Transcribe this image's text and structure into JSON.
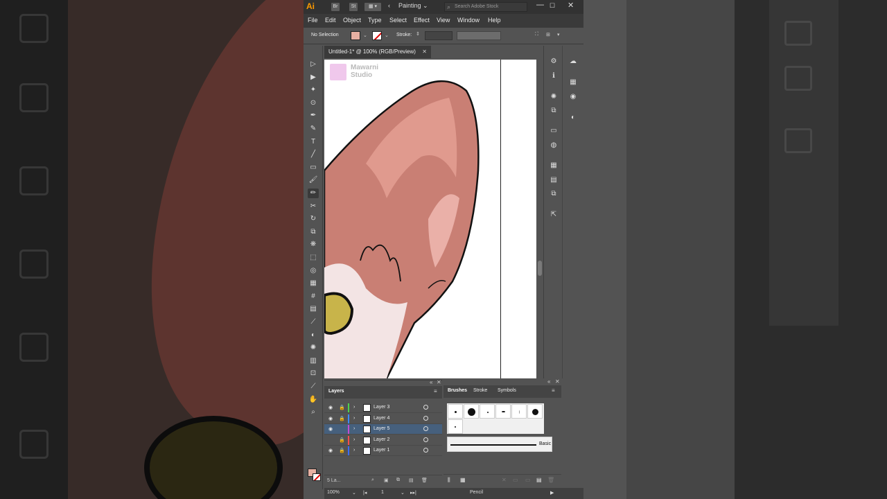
{
  "app": {
    "logo": "Ai",
    "bridge_btn": "Br",
    "stock_btn": "St",
    "workspace": "Painting",
    "stock_search_placeholder": "Search Adobe Stock",
    "window_controls": [
      "—",
      "☐",
      "✕"
    ]
  },
  "menubar": [
    "File",
    "Edit",
    "Object",
    "Type",
    "Select",
    "Effect",
    "View",
    "Window",
    "Help"
  ],
  "control_bar": {
    "selection": "No Selection",
    "stroke_label": "Stroke:",
    "fill_color": "#e8b0a2"
  },
  "document": {
    "tab_title": "Untitled-1* @ 100% (RGB/Preview)",
    "close": "✕",
    "watermark": "Mawarni Studio"
  },
  "tools": [
    {
      "name": "selection-tool",
      "glyph": "▷"
    },
    {
      "name": "direct-selection-tool",
      "glyph": "▶"
    },
    {
      "name": "magic-wand-tool",
      "glyph": "✦"
    },
    {
      "name": "lasso-tool",
      "glyph": "⊙"
    },
    {
      "name": "pen-tool",
      "glyph": "✒"
    },
    {
      "name": "curvature-tool",
      "glyph": "✎"
    },
    {
      "name": "type-tool",
      "glyph": "T"
    },
    {
      "name": "line-tool",
      "glyph": "╱"
    },
    {
      "name": "rectangle-tool",
      "glyph": "▭"
    },
    {
      "name": "paintbrush-tool",
      "glyph": "🖌"
    },
    {
      "name": "pencil-tool",
      "glyph": "✏"
    },
    {
      "name": "scissors-tool",
      "glyph": "✂"
    },
    {
      "name": "rotate-tool",
      "glyph": "↻"
    },
    {
      "name": "scale-tool",
      "glyph": "⧉"
    },
    {
      "name": "warp-tool",
      "glyph": "❋"
    },
    {
      "name": "free-transform-tool",
      "glyph": "⬚"
    },
    {
      "name": "shape-builder-tool",
      "glyph": "◎"
    },
    {
      "name": "perspective-grid-tool",
      "glyph": "▦"
    },
    {
      "name": "mesh-tool",
      "glyph": "#"
    },
    {
      "name": "gradient-tool",
      "glyph": "▤"
    },
    {
      "name": "eyedropper-tool",
      "glyph": "⟋"
    },
    {
      "name": "blend-tool",
      "glyph": "◐"
    },
    {
      "name": "symbol-sprayer-tool",
      "glyph": "✺"
    },
    {
      "name": "column-graph-tool",
      "glyph": "▥"
    },
    {
      "name": "artboard-tool",
      "glyph": "⊡"
    },
    {
      "name": "slice-tool",
      "glyph": "⟋"
    },
    {
      "name": "hand-tool",
      "glyph": "✋"
    },
    {
      "name": "zoom-tool",
      "glyph": "⌕"
    }
  ],
  "right_panel_icons_a": [
    "⚙",
    "ℹ",
    "✺",
    "⧉",
    "▭",
    "◍",
    "▦",
    "▤",
    "⧉",
    "⇱"
  ],
  "right_panel_icons_b": [
    "☁",
    "▦",
    "◉",
    "◐"
  ],
  "layers_panel": {
    "tab": "Layers",
    "count_label": "5 La...",
    "layers": [
      {
        "name": "Layer 3",
        "color": "#4cd34c",
        "visible": true,
        "locked": true,
        "selected": false
      },
      {
        "name": "Layer 4",
        "color": "#3a8cff",
        "visible": true,
        "locked": true,
        "selected": false
      },
      {
        "name": "Layer 5",
        "color": "#c34cd3",
        "visible": true,
        "locked": false,
        "selected": true
      },
      {
        "name": "Layer 2",
        "color": "#ff4c4c",
        "visible": false,
        "locked": true,
        "selected": false
      },
      {
        "name": "Layer 1",
        "color": "#3a6cff",
        "visible": true,
        "locked": true,
        "selected": false
      }
    ]
  },
  "brushes_panel": {
    "tabs": [
      "Brushes",
      "Stroke",
      "Symbols"
    ],
    "basic_label": "Basic"
  },
  "status_bar": {
    "zoom": "100%",
    "artboard": "1",
    "tool": "Pencil"
  }
}
